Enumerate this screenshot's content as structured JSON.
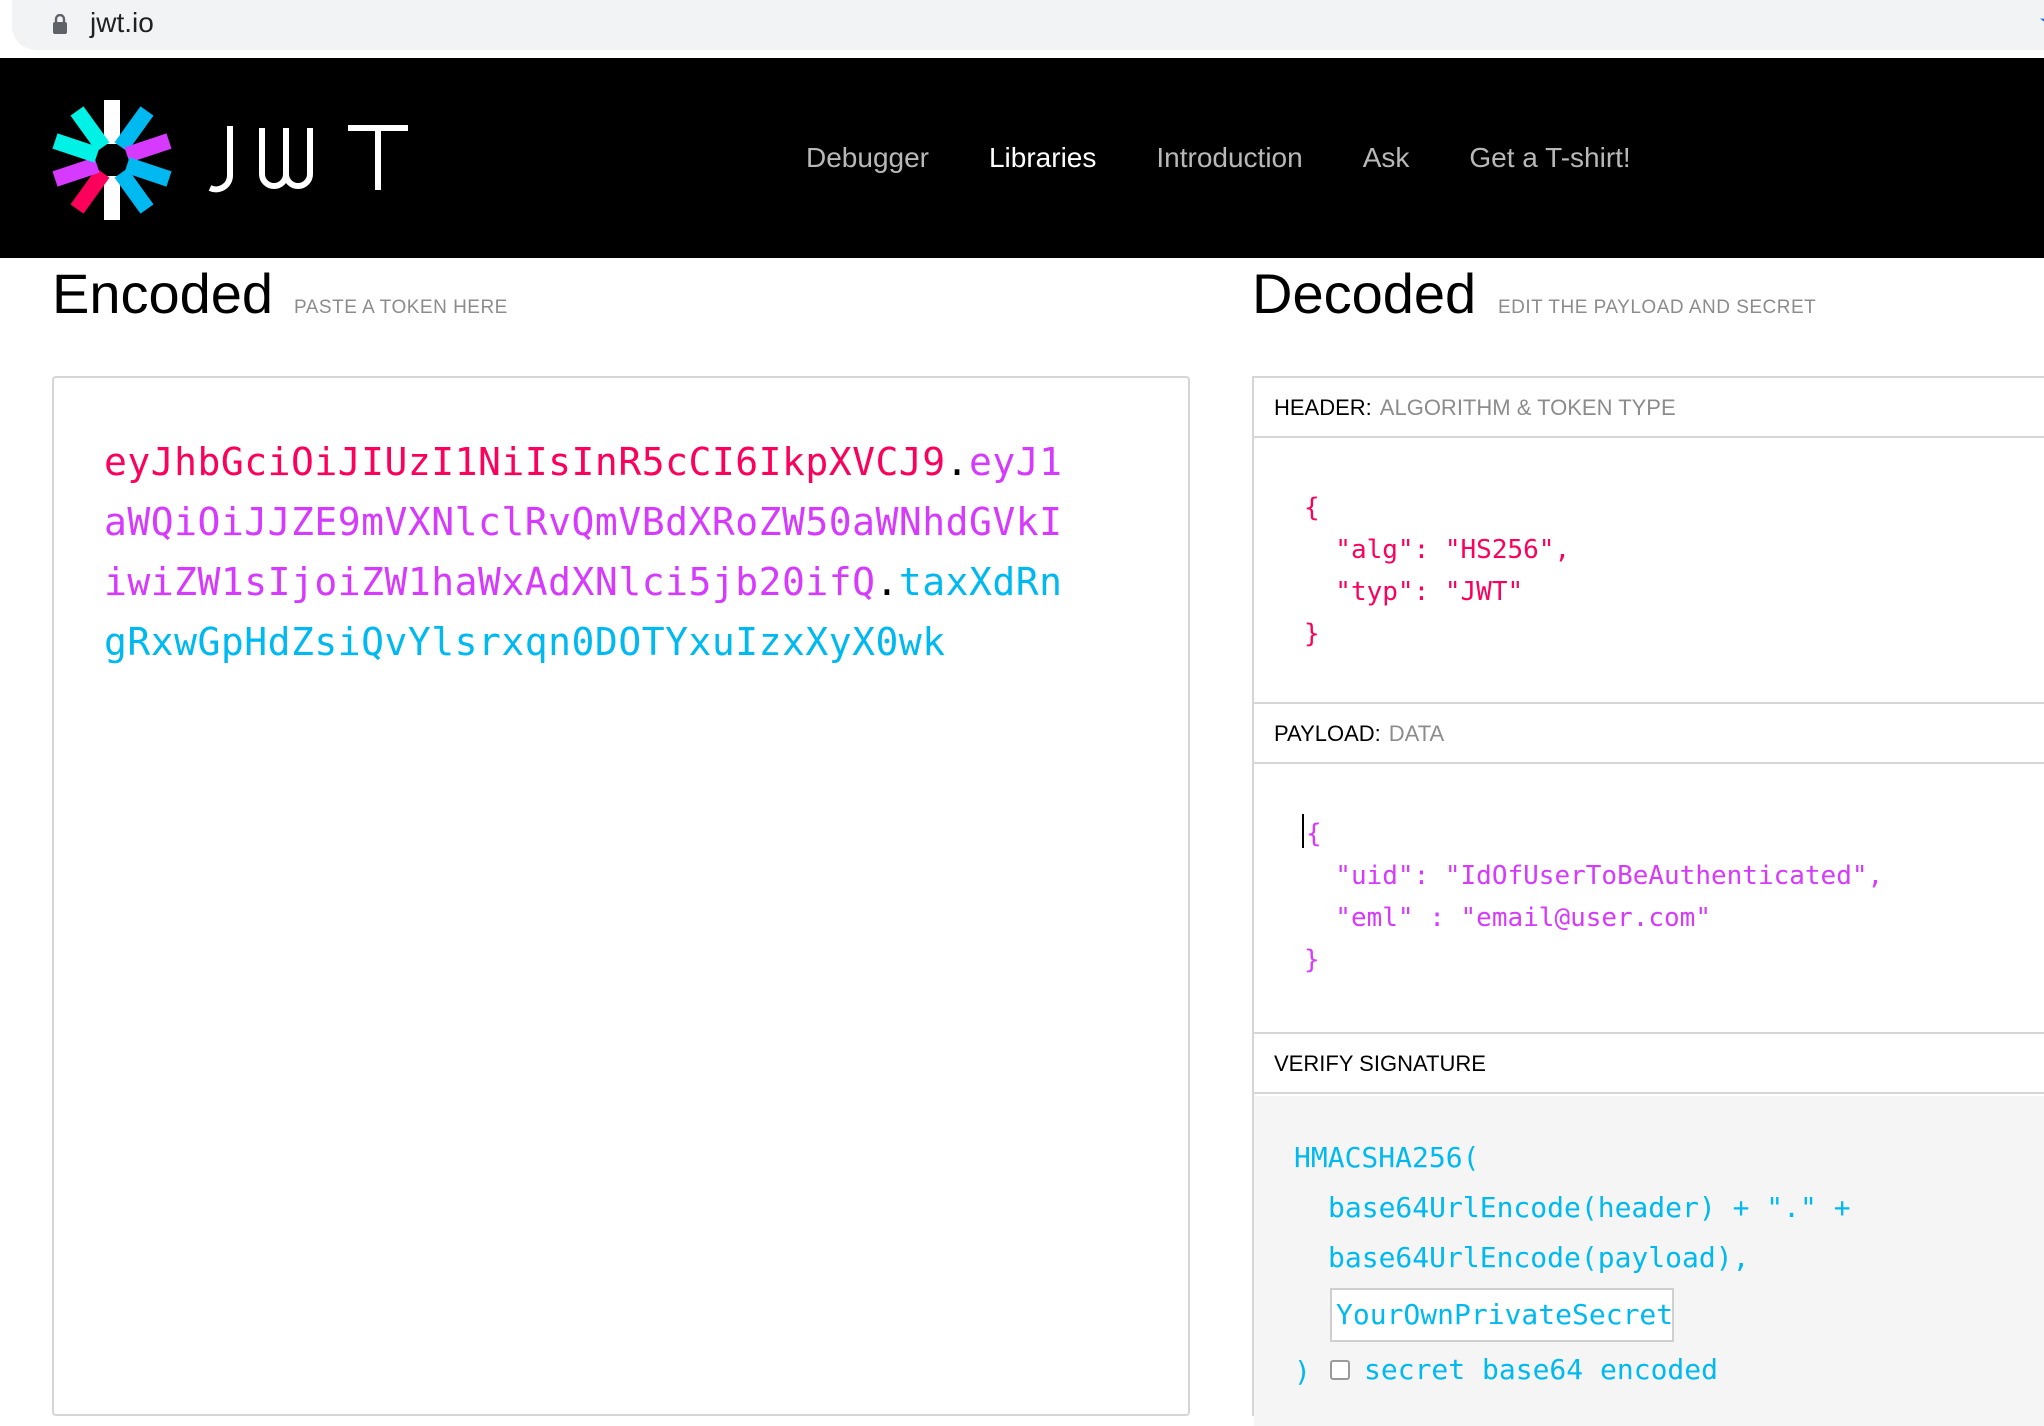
{
  "browser": {
    "url": "jwt.io"
  },
  "nav": {
    "logo_alt": "JWT",
    "links": [
      {
        "label": "Debugger",
        "active": false
      },
      {
        "label": "Libraries",
        "active": true
      },
      {
        "label": "Introduction",
        "active": false
      },
      {
        "label": "Ask",
        "active": false
      },
      {
        "label": "Get a T-shirt!",
        "active": false
      }
    ]
  },
  "encoded": {
    "title": "Encoded",
    "subtitle": "PASTE A TOKEN HERE",
    "token_header": "eyJhbGciOiJIUzI1NiIsInR5cCI6IkpXVCJ9",
    "token_payload": "eyJ1aWQiOiJJZE9mVXNlclRvQmVBdXRoZW50aWNhdGVkIiwiZW1sIjoiZW1haWxAdXNlci5jb20ifQ",
    "token_signature": "taxXdRngRxwGpHdZsiQvYlsrxqn0DOTYxuIzxXyX0wk",
    "dot": "."
  },
  "decoded": {
    "title": "Decoded",
    "subtitle": "EDIT THE PAYLOAD AND SECRET",
    "header_section": {
      "label": "HEADER:",
      "sublabel": "ALGORITHM & TOKEN TYPE",
      "lines": [
        "{",
        "  \"alg\": \"HS256\",",
        "  \"typ\": \"JWT\"",
        "}"
      ]
    },
    "payload_section": {
      "label": "PAYLOAD:",
      "sublabel": "DATA",
      "lines": [
        "{",
        "  \"uid\": \"IdOfUserToBeAuthenticated\",",
        "  \"eml\" : \"email@user.com\"",
        "}"
      ]
    },
    "verify_section": {
      "label": "VERIFY SIGNATURE",
      "line1": "HMACSHA256(",
      "line2": "base64UrlEncode(header) + \".\" +",
      "line3": "base64UrlEncode(payload),",
      "secret_value": "YourOwnPrivateSecret",
      "close_paren": ")",
      "b64_label": "secret base64 encoded",
      "b64_checked": false
    }
  },
  "colors": {
    "header": "#fb015b",
    "payload": "#d63aff",
    "signature": "#00b9f1"
  }
}
